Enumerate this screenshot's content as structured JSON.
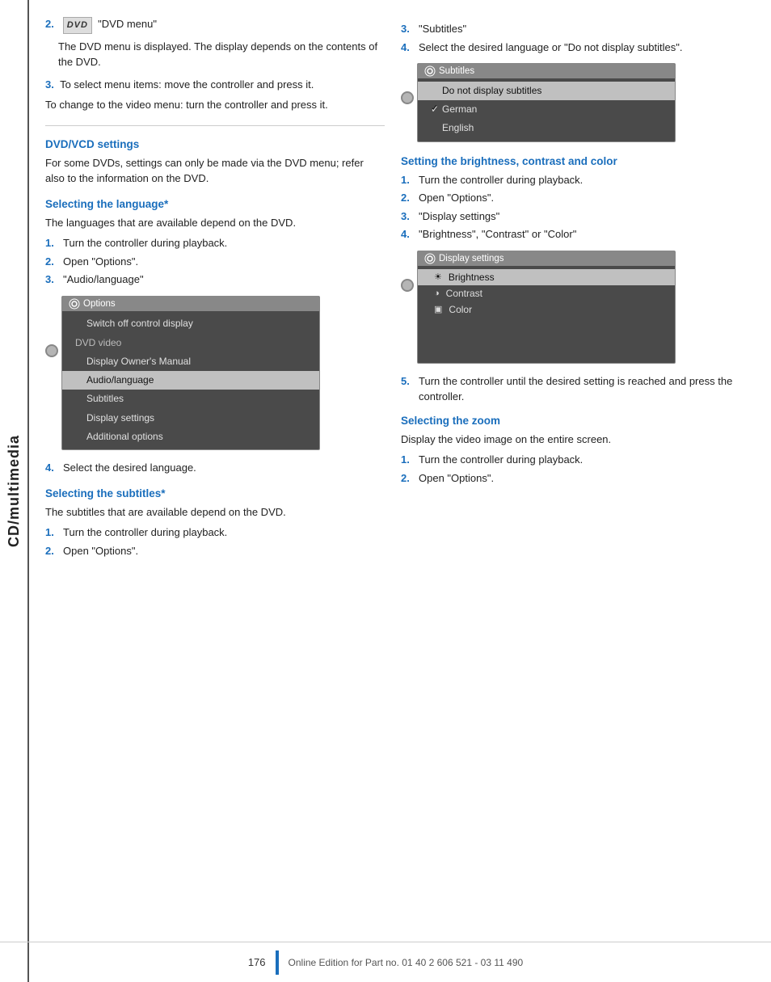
{
  "sidebar": {
    "label": "CD/multimedia"
  },
  "page": {
    "number": "176",
    "footer": "Online Edition for Part no. 01 40 2 606 521 - 03 11 490"
  },
  "left_col": {
    "intro_step2_num": "2.",
    "intro_step2_label": "\"DVD menu\"",
    "intro_step2_desc": "The DVD menu is displayed. The display depends on the contents of the DVD.",
    "intro_step3_num": "3.",
    "intro_step3_text": "To select menu items: move the controller and press it.",
    "intro_step3b_text": "To change to the video menu: turn the controller and press it.",
    "dvd_settings_heading": "DVD/VCD settings",
    "dvd_settings_desc": "For some DVDs, settings can only be made via the DVD menu; refer also to the information on the DVD.",
    "lang_heading": "Selecting the language*",
    "lang_desc": "The languages that are available depend on the DVD.",
    "lang_steps": [
      {
        "num": "1.",
        "text": "Turn the controller during playback."
      },
      {
        "num": "2.",
        "text": "Open \"Options\"."
      },
      {
        "num": "3.",
        "text": "\"Audio/language\""
      }
    ],
    "options_menu": {
      "title": "Options",
      "items": [
        {
          "label": "Switch off control display",
          "type": "normal"
        },
        {
          "label": "DVD video",
          "type": "section"
        },
        {
          "label": "Display Owner's Manual",
          "type": "normal"
        },
        {
          "label": "Audio/language",
          "type": "highlighted"
        },
        {
          "label": "Subtitles",
          "type": "normal"
        },
        {
          "label": "Display settings",
          "type": "normal"
        },
        {
          "label": "Additional options",
          "type": "normal"
        }
      ]
    },
    "lang_step4_num": "4.",
    "lang_step4_text": "Select the desired language.",
    "subtitles_heading": "Selecting the subtitles*",
    "subtitles_desc": "The subtitles that are available depend on the DVD.",
    "subtitles_steps": [
      {
        "num": "1.",
        "text": "Turn the controller during playback."
      },
      {
        "num": "2.",
        "text": "Open \"Options\"."
      }
    ]
  },
  "right_col": {
    "subtitles_step3_num": "3.",
    "subtitles_step3_text": "\"Subtitles\"",
    "subtitles_step4_num": "4.",
    "subtitles_step4_text": "Select the desired language or \"Do not display subtitles\".",
    "subtitles_menu": {
      "title": "Subtitles",
      "items": [
        {
          "label": "Do not display subtitles",
          "type": "highlighted"
        },
        {
          "label": "German",
          "type": "check"
        },
        {
          "label": "English",
          "type": "normal"
        }
      ]
    },
    "brightness_heading": "Setting the brightness, contrast and color",
    "brightness_steps": [
      {
        "num": "1.",
        "text": "Turn the controller during playback."
      },
      {
        "num": "2.",
        "text": "Open \"Options\"."
      },
      {
        "num": "3.",
        "text": "\"Display settings\""
      },
      {
        "num": "4.",
        "text": "\"Brightness\", \"Contrast\" or \"Color\""
      }
    ],
    "display_menu": {
      "title": "Display settings",
      "items": [
        {
          "label": "Brightness",
          "type": "highlighted",
          "icon": "☀"
        },
        {
          "label": "Contrast",
          "type": "normal",
          "icon": "◑"
        },
        {
          "label": "Color",
          "type": "normal",
          "icon": "▣"
        }
      ]
    },
    "brightness_step5_num": "5.",
    "brightness_step5_text": "Turn the controller until the desired setting is reached and press the controller.",
    "zoom_heading": "Selecting the zoom",
    "zoom_desc": "Display the video image on the entire screen.",
    "zoom_steps": [
      {
        "num": "1.",
        "text": "Turn the controller during playback."
      },
      {
        "num": "2.",
        "text": "Open \"Options\"."
      }
    ]
  }
}
